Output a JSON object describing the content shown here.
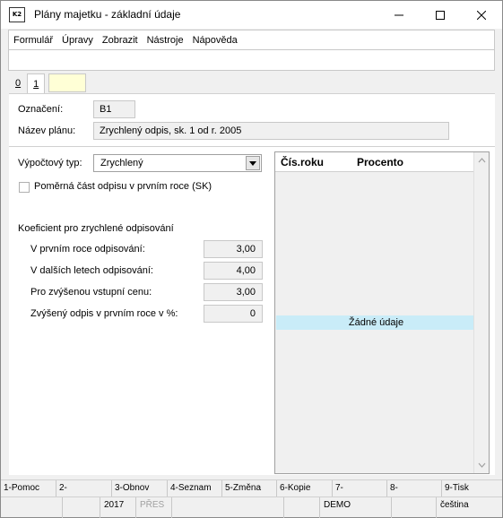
{
  "window": {
    "title": "Plány majetku - základní údaje",
    "icon_label": "K2"
  },
  "menu": [
    "Formulář",
    "Úpravy",
    "Zobrazit",
    "Nástroje",
    "Nápověda"
  ],
  "tabs": [
    {
      "label": "0",
      "active": false
    },
    {
      "label": "1",
      "active": true
    }
  ],
  "header": {
    "oznaceni_label": "Označení:",
    "oznaceni_value": "B1",
    "nazev_label": "Název plánu:",
    "nazev_value": "Zrychlený odpis, sk. 1 od r. 2005"
  },
  "form": {
    "vypoctovy_typ_label": "Výpočtový typ:",
    "vypoctovy_typ_value": "Zrychlený",
    "pomerna_cast_label": "Poměrná část odpisu v prvním roce (SK)",
    "pomerna_cast_checked": false,
    "koeficient_title": "Koeficient pro zrychlené odpisování",
    "rows": [
      {
        "label": "V prvním roce odpisování:",
        "value": "3,00"
      },
      {
        "label": "V dalších letech odpisování:",
        "value": "4,00"
      },
      {
        "label": "Pro zvýšenou vstupní cenu:",
        "value": "3,00"
      },
      {
        "label": "Zvýšený odpis v prvním roce v %:",
        "value": "0"
      }
    ]
  },
  "grid": {
    "columns": [
      "Čís.roku",
      "Procento"
    ],
    "empty_text": "Žádné údaje"
  },
  "function_keys": [
    "1-Pomoc",
    "2-",
    "3-Obnov",
    "4-Seznam",
    "5-Změna",
    "6-Kopie",
    "7-",
    "8-",
    "9-Tisk"
  ],
  "status": {
    "year": "2017",
    "mode": "PŘES",
    "db": "DEMO",
    "language": "čeština"
  }
}
